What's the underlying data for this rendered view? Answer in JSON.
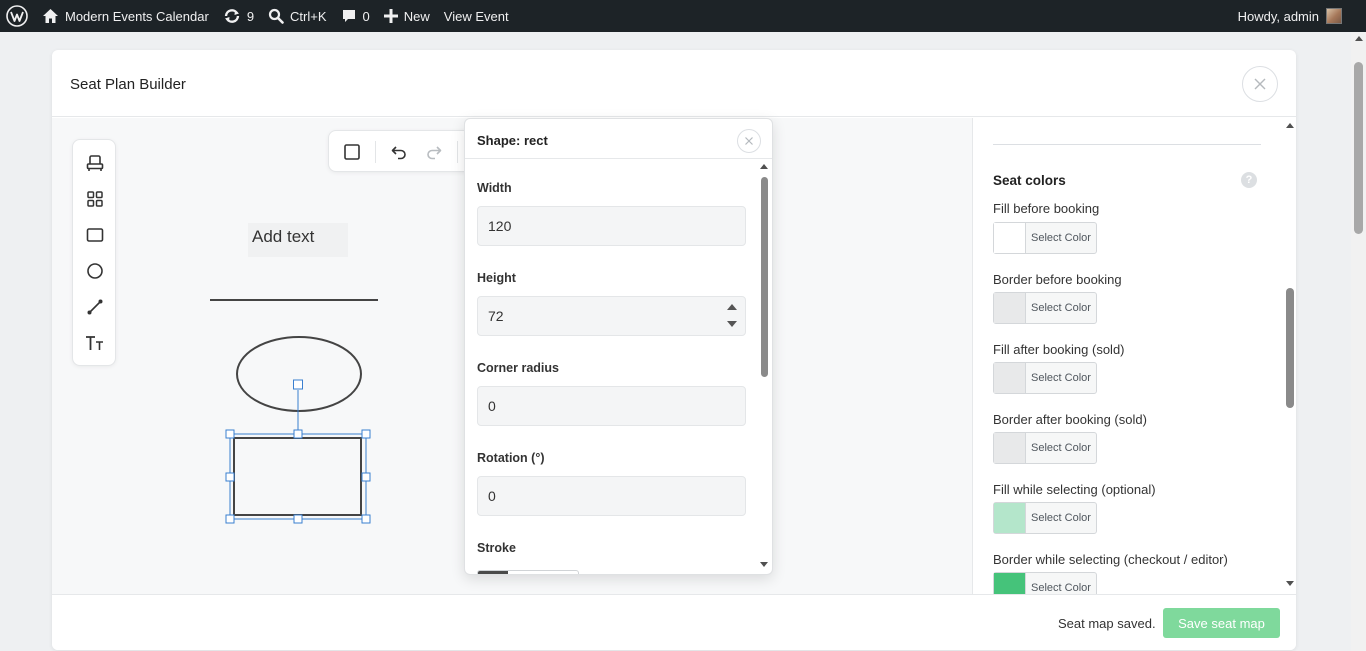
{
  "admin_bar": {
    "site_name": "Modern Events Calendar",
    "updates_count": "9",
    "search_shortcut": "Ctrl+K",
    "comments_count": "0",
    "new_label": "New",
    "view_label": "View Event",
    "greeting": "Howdy, admin"
  },
  "modal": {
    "title": "Seat Plan Builder",
    "canvas_text": "Add text",
    "palette_tools": [
      "seat-icon",
      "grid-icon",
      "rectangle-icon",
      "circle-icon",
      "line-icon",
      "text-icon"
    ],
    "toolbar_tools": [
      "select-icon",
      "undo-icon",
      "redo-icon"
    ]
  },
  "shape_panel": {
    "title": "Shape: rect",
    "fields": [
      {
        "label": "Width",
        "value": "120"
      },
      {
        "label": "Height",
        "value": "72"
      },
      {
        "label": "Corner radius",
        "value": "0"
      },
      {
        "label": "Rotation (°)",
        "value": "0"
      }
    ],
    "stroke_label": "Stroke",
    "stroke_color": "#4a4a4a"
  },
  "sidebar": {
    "section_title": "Seat colors",
    "help": "?",
    "colors": [
      {
        "label": "Fill before booking",
        "swatch": "#ffffff",
        "button": "Select Color"
      },
      {
        "label": "Border before booking",
        "swatch": "#e8e9ea",
        "button": "Select Color"
      },
      {
        "label": "Fill after booking (sold)",
        "swatch": "#e8e9ea",
        "button": "Select Color"
      },
      {
        "label": "Border after booking (sold)",
        "swatch": "#e8e9ea",
        "button": "Select Color"
      },
      {
        "label": "Fill while selecting (optional)",
        "swatch": "#b4e6cb",
        "button": "Select Color"
      },
      {
        "label": "Border while selecting (checkout / editor)",
        "swatch": "#45c37a",
        "button": "Select Color"
      }
    ]
  },
  "footer": {
    "status": "Seat map saved.",
    "save_button": "Save seat map",
    "save_button_color": "#7fd99c"
  }
}
